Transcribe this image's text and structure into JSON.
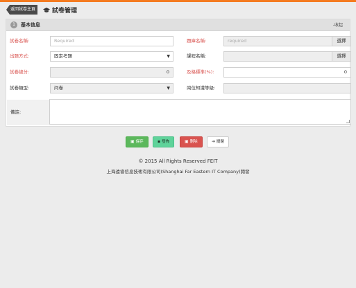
{
  "header": {
    "back_label": "返回試卷主頁",
    "title": "試卷管理",
    "title_icon": "graduation-cap-icon"
  },
  "panel": {
    "step": "1",
    "title": "基本信息",
    "collapse_label": "-收起"
  },
  "form": {
    "exam_name": {
      "label": "試卷名稱:",
      "placeholder": "Required",
      "required": true
    },
    "question_bank": {
      "label": "題庫名稱:",
      "placeholder": "required",
      "button": "選擇",
      "required": true
    },
    "method": {
      "label": "出題方式:",
      "value": "固定考題",
      "required": true
    },
    "course": {
      "label": "課程名稱:",
      "value": "",
      "button": "選擇",
      "required": false
    },
    "total": {
      "label": "試卷總分:",
      "value": "0",
      "required": true
    },
    "pass_rate": {
      "label": "及格標準(%):",
      "value": "0",
      "required": true
    },
    "type": {
      "label": "試卷類型:",
      "value": "问卷",
      "required": false
    },
    "level": {
      "label": "崗位知識等級:",
      "value": "",
      "required": false
    },
    "remark": {
      "label": "備註:",
      "value": ""
    }
  },
  "actions": {
    "save": "保存",
    "publish": "發佈",
    "delete": "刪除",
    "close": "關閉"
  },
  "footer": {
    "copyright": "© 2015 All Rights Reserved FEIT",
    "company": "上海遠睿信息技術有限公司(Shanghai Far Eastern IT Company)開發"
  },
  "colors": {
    "accent": "#f47b20",
    "required_label": "#d9534f",
    "save": "#5cb85c",
    "publish": "#5fd39a",
    "delete": "#d9534f"
  }
}
